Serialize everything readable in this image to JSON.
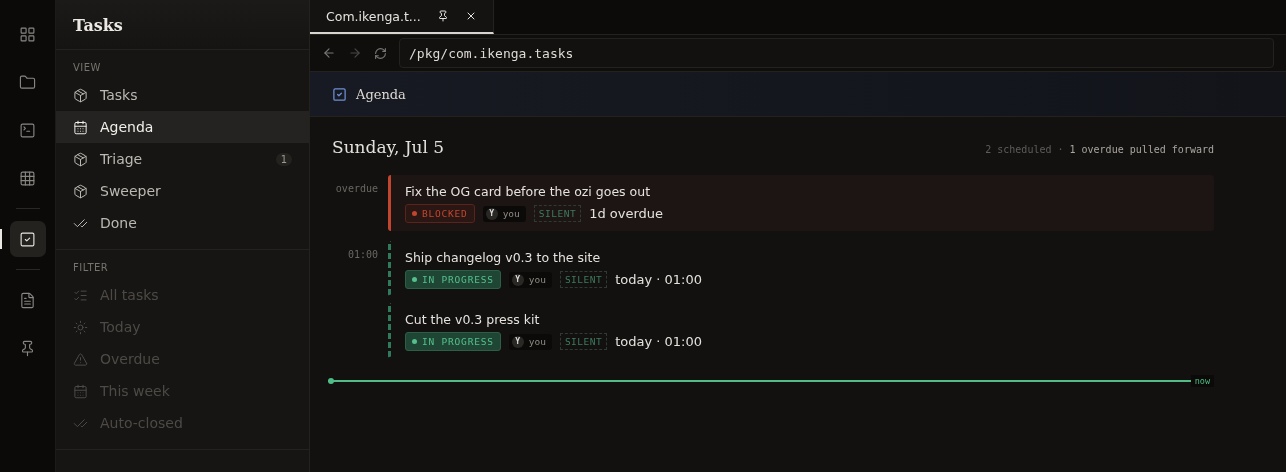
{
  "rail": {
    "items": [
      {
        "selected": false
      },
      {
        "selected": false
      },
      {
        "selected": false
      },
      {
        "selected": false
      },
      {
        "selected": true
      },
      {
        "selected": false
      },
      {
        "selected": false
      }
    ]
  },
  "sidebar": {
    "title": "Tasks",
    "sections": [
      {
        "heading": "VIEW",
        "items": [
          {
            "label": "Tasks",
            "selected": false,
            "disabled": false
          },
          {
            "label": "Agenda",
            "selected": true,
            "disabled": false
          },
          {
            "label": "Triage",
            "selected": false,
            "disabled": false,
            "badge": "1"
          },
          {
            "label": "Sweeper",
            "selected": false,
            "disabled": false
          },
          {
            "label": "Done",
            "selected": false,
            "disabled": false
          }
        ]
      },
      {
        "heading": "FILTER",
        "items": [
          {
            "label": "All tasks",
            "selected": false,
            "disabled": true
          },
          {
            "label": "Today",
            "selected": false,
            "disabled": true
          },
          {
            "label": "Overdue",
            "selected": false,
            "disabled": true
          },
          {
            "label": "This week",
            "selected": false,
            "disabled": true
          },
          {
            "label": "Auto-closed",
            "selected": false,
            "disabled": true
          }
        ]
      }
    ]
  },
  "tabs": [
    {
      "label": "Com.ikenga.t...",
      "selected": true
    }
  ],
  "address": {
    "value": "/pkg/com.ikenga.tasks"
  },
  "header": {
    "title": "Agenda"
  },
  "agenda": {
    "date": "Sunday, Jul 5",
    "meta": [
      "2 scheduled",
      "·",
      "1 overdue pulled forward"
    ],
    "groups": [
      {
        "time": "overdue",
        "kind": "overdue",
        "tasks": [
          {
            "title": "Fix the OG card before the ozi goes out",
            "status": "BLOCKED",
            "kind": "blocked",
            "avatar": "Y",
            "owner": "you",
            "tag": "SILENT",
            "due": "1d overdue"
          }
        ]
      },
      {
        "time": "01:00",
        "kind": "scheduled",
        "tasks": [
          {
            "title": "Ship changelog v0.3 to the site",
            "status": "IN PROGRESS",
            "kind": "progress",
            "avatar": "Y",
            "owner": "you",
            "tag": "SILENT",
            "due": "today · 01:00"
          },
          {
            "title": "Cut the v0.3 press kit",
            "status": "IN PROGRESS",
            "kind": "progress",
            "avatar": "Y",
            "owner": "you",
            "tag": "SILENT",
            "due": "today · 01:00"
          }
        ]
      }
    ],
    "now": "now"
  }
}
